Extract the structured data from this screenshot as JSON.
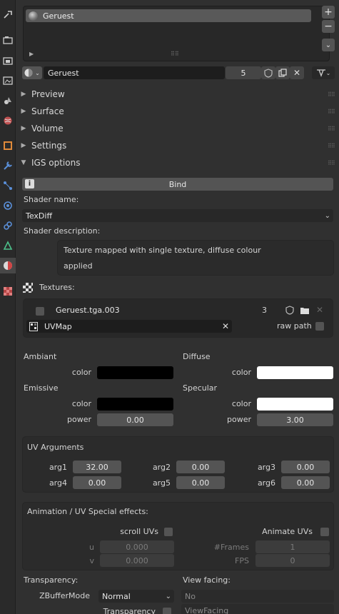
{
  "tabs": [
    "tool-icon",
    "render-icon",
    "output-icon",
    "view-layer-icon",
    "scene-icon",
    "world-icon",
    "object-icon",
    "modifier-icon",
    "particles-icon",
    "physics-icon",
    "constraints-icon",
    "data-icon",
    "material-icon",
    "texture-icon"
  ],
  "slot": {
    "name": "Geruest"
  },
  "material": {
    "name": "Geruest",
    "users": "5"
  },
  "sections": {
    "preview": "Preview",
    "surface": "Surface",
    "volume": "Volume",
    "settings": "Settings",
    "igs": "IGS options"
  },
  "igs": {
    "bind_label": "Bind",
    "shader_name_label": "Shader name:",
    "shader_name_value": "TexDiff",
    "shader_desc_label": "Shader description:",
    "shader_desc_line1": "Texture mapped with single texture, diffuse colour",
    "shader_desc_line2": "applied",
    "textures_label": "Textures:",
    "texture_name": "Geruest.tga.003",
    "texture_users": "3",
    "uvmap": "UVMap",
    "raw_path_label": "raw path"
  },
  "colors_panel": {
    "ambient": "Ambiant",
    "diffuse": "Diffuse",
    "emissive": "Emissive",
    "specular": "Specular",
    "color_label": "color",
    "power_label": "power",
    "emissive_power": "0.00",
    "specular_power": "3.00",
    "ambient_color": "#000000",
    "diffuse_color": "#ffffff",
    "emissive_color": "#000000",
    "specular_color": "#ffffff"
  },
  "uv": {
    "title": "UV Arguments",
    "args": [
      {
        "label": "arg1",
        "value": "32.00"
      },
      {
        "label": "arg2",
        "value": "0.00"
      },
      {
        "label": "arg3",
        "value": "0.00"
      },
      {
        "label": "arg4",
        "value": "0.00"
      },
      {
        "label": "arg5",
        "value": "0.00"
      },
      {
        "label": "arg6",
        "value": "0.00"
      }
    ]
  },
  "anim": {
    "title": "Animation / UV Special effects:",
    "scroll_uvs": "scroll UVs",
    "animate_uvs": "Animate UVs",
    "u_label": "u",
    "v_label": "v",
    "u_value": "0.000",
    "v_value": "0.000",
    "frames_label": "#Frames",
    "fps_label": "FPS",
    "frames_value": "1",
    "fps_value": "0"
  },
  "transparency": {
    "title": "Transparency:",
    "zbuffer_label": "ZBufferMode",
    "zbuffer_value": "Normal",
    "transparency_label": "Transparency",
    "view_facing_title": "View facing:",
    "view_no": "No",
    "view_facing": "ViewFacing"
  }
}
